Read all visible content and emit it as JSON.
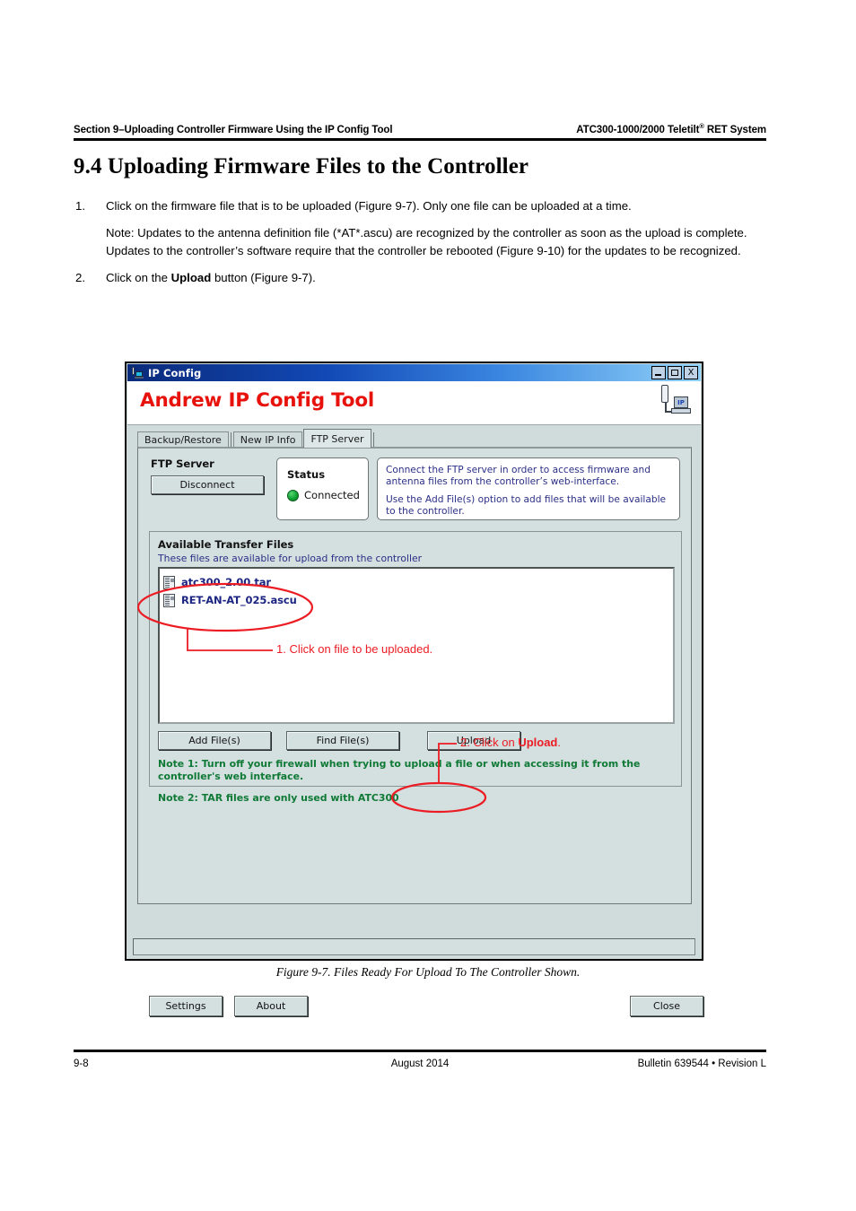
{
  "running_head": {
    "left": "Section 9–Uploading Controller Firmware Using the IP Config Tool",
    "right_main": "ATC300-1000/2000 Teletilt",
    "right_sup": "®",
    "right_tail": " RET System"
  },
  "section": {
    "title": "9.4 Uploading Firmware Files to the Controller"
  },
  "steps": [
    {
      "num": "1.",
      "text": "Click on the firmware file that is to be uploaded (Figure 9-7). Only one file can be uploaded at a time."
    },
    {
      "num": "2.",
      "text_pre": "Click on the ",
      "text_bold": "Upload",
      "text_post": " button (Figure 9-7)."
    }
  ],
  "note_paragraph": "Note: Updates to the antenna definition file (*AT*.ascu) are recognized by the controller as soon as the upload is complete. Updates to the controller’s software require that the controller be rebooted (Figure 9-10) for the updates to be recognized.",
  "window": {
    "title": "IP Config",
    "title_icon": "antenna-computer-icon",
    "minimize_label": "_",
    "maximize_label": "□",
    "close_label": "X",
    "brand": "Andrew IP Config Tool",
    "brand_icon_label": "IP",
    "brand_color": "#e8120c",
    "tabs": [
      {
        "label": "Backup/Restore",
        "active": false
      },
      {
        "label": "New IP Info",
        "active": false
      },
      {
        "label": "FTP Server",
        "active": true
      }
    ],
    "ftp_server": {
      "group_label": "FTP Server",
      "disconnect_button": "Disconnect",
      "status_title": "Status",
      "status_value": "Connected",
      "status_color": "#11a436",
      "info_lines": [
        "Connect the FTP server in order to access firmware and antenna files from the controller’s web-interface.",
        "Use the Add File(s) option to add files that will be available to the controller."
      ]
    },
    "available_transfer_files": {
      "group_label": "Available Transfer Files",
      "subtitle": "These files are available for upload from the controller",
      "files": [
        {
          "name": "atc300_2.00.tar",
          "icon": "file-icon"
        },
        {
          "name": "RET-AN-AT_025.ascu",
          "icon": "file-icon"
        }
      ],
      "buttons": [
        "Add File(s)",
        "Find File(s)",
        "Upload"
      ],
      "notes": [
        "Note 1: Turn off your firewall when trying to upload a file or when accessing it from the controller's web interface.",
        "Note 2: TAR files are only used with ATC300"
      ],
      "notes_color": "#0f7a36"
    },
    "footer_buttons": {
      "settings": "Settings",
      "about": "About",
      "close": "Close"
    }
  },
  "annotations": {
    "color": "#ec1c24",
    "callout_1": "1.  Click on file to be uploaded.",
    "callout_2_pre": "2.  Click on ",
    "callout_2_bold": "Upload",
    "callout_2_post": "."
  },
  "caption": "Figure 9-7.  Files Ready For Upload To The Controller Shown.",
  "page_footer": {
    "left": "9-8",
    "middle": "August 2014",
    "right": "Bulletin 639544  •  Revision L"
  }
}
